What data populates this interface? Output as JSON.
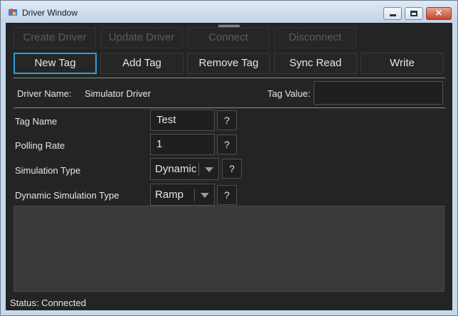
{
  "window": {
    "title": "Driver Window",
    "icon": "app-icon"
  },
  "toolbar1": [
    {
      "label": "Create Driver",
      "enabled": false
    },
    {
      "label": "Update Driver",
      "enabled": false
    },
    {
      "label": "Connect",
      "enabled": false
    },
    {
      "label": "Disconnect",
      "enabled": false
    }
  ],
  "toolbar2": [
    {
      "label": "New Tag"
    },
    {
      "label": "Add Tag"
    },
    {
      "label": "Remove Tag"
    },
    {
      "label": "Sync Read"
    },
    {
      "label": "Write"
    }
  ],
  "driver": {
    "name_label": "Driver Name:",
    "name_value": "Simulator Driver",
    "tag_value_label": "Tag Value:",
    "tag_value": ""
  },
  "form": {
    "tag_name_label": "Tag Name",
    "tag_name_value": "Test",
    "polling_rate_label": "Polling Rate",
    "polling_rate_value": "1",
    "sim_type_label": "Simulation Type",
    "sim_type_value": "Dynamic",
    "dyn_sim_type_label": "Dynamic Simulation Type",
    "dyn_sim_type_value": "Ramp",
    "help_label": "?"
  },
  "status": {
    "text": "Status: Connected"
  },
  "colors": {
    "accent": "#2ba0d8",
    "background": "#242424",
    "panel": "#3a3a3a",
    "text": "#e6e6e6",
    "disabled_text": "#5c5c5c"
  }
}
